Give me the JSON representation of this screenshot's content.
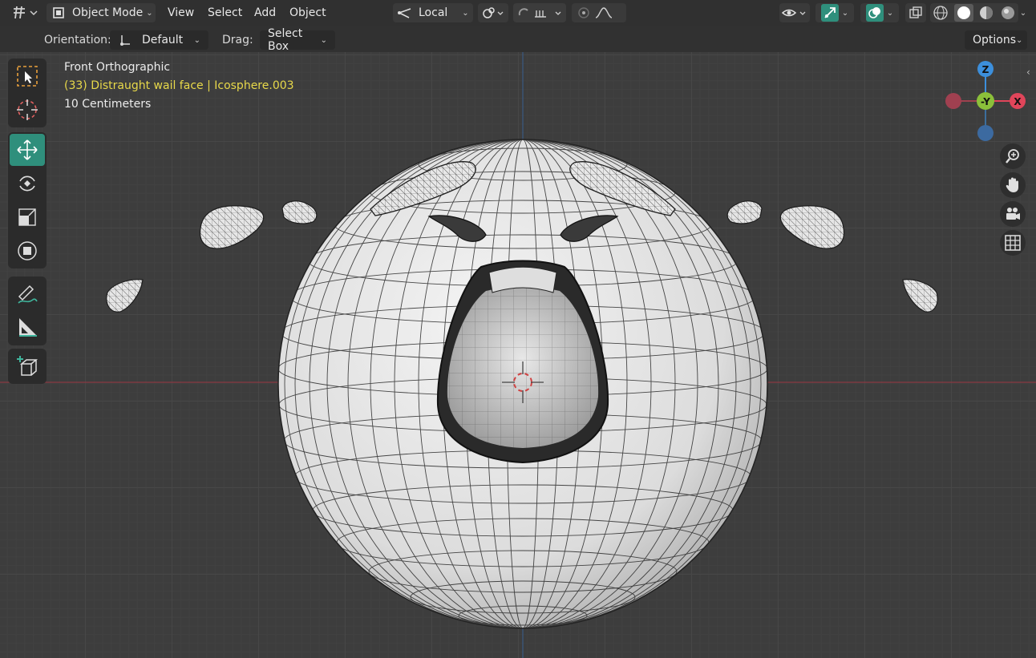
{
  "header": {
    "mode_label": "Object Mode",
    "menu_view": "View",
    "menu_select": "Select",
    "menu_add": "Add",
    "menu_object": "Object",
    "pivot_label": "Local"
  },
  "tool_settings": {
    "orientation_label": "Orientation:",
    "orientation_value": "Default",
    "drag_label": "Drag:",
    "drag_value": "Select Box",
    "options_label": "Options"
  },
  "viewport_info": {
    "view_name": "Front Orthographic",
    "object_info": "(33) Distraught wail face | Icosphere.003",
    "scale_info": "10 Centimeters"
  },
  "gizmo": {
    "z_label": "Z",
    "neg_y_label": "-Y",
    "x_label": "X"
  },
  "colors": {
    "accent": "#2f8f7c",
    "object_info_text": "#e8d94a",
    "x_axis": "#e0455a",
    "y_axis": "#8bc03a",
    "z_axis": "#3c8fdc"
  }
}
